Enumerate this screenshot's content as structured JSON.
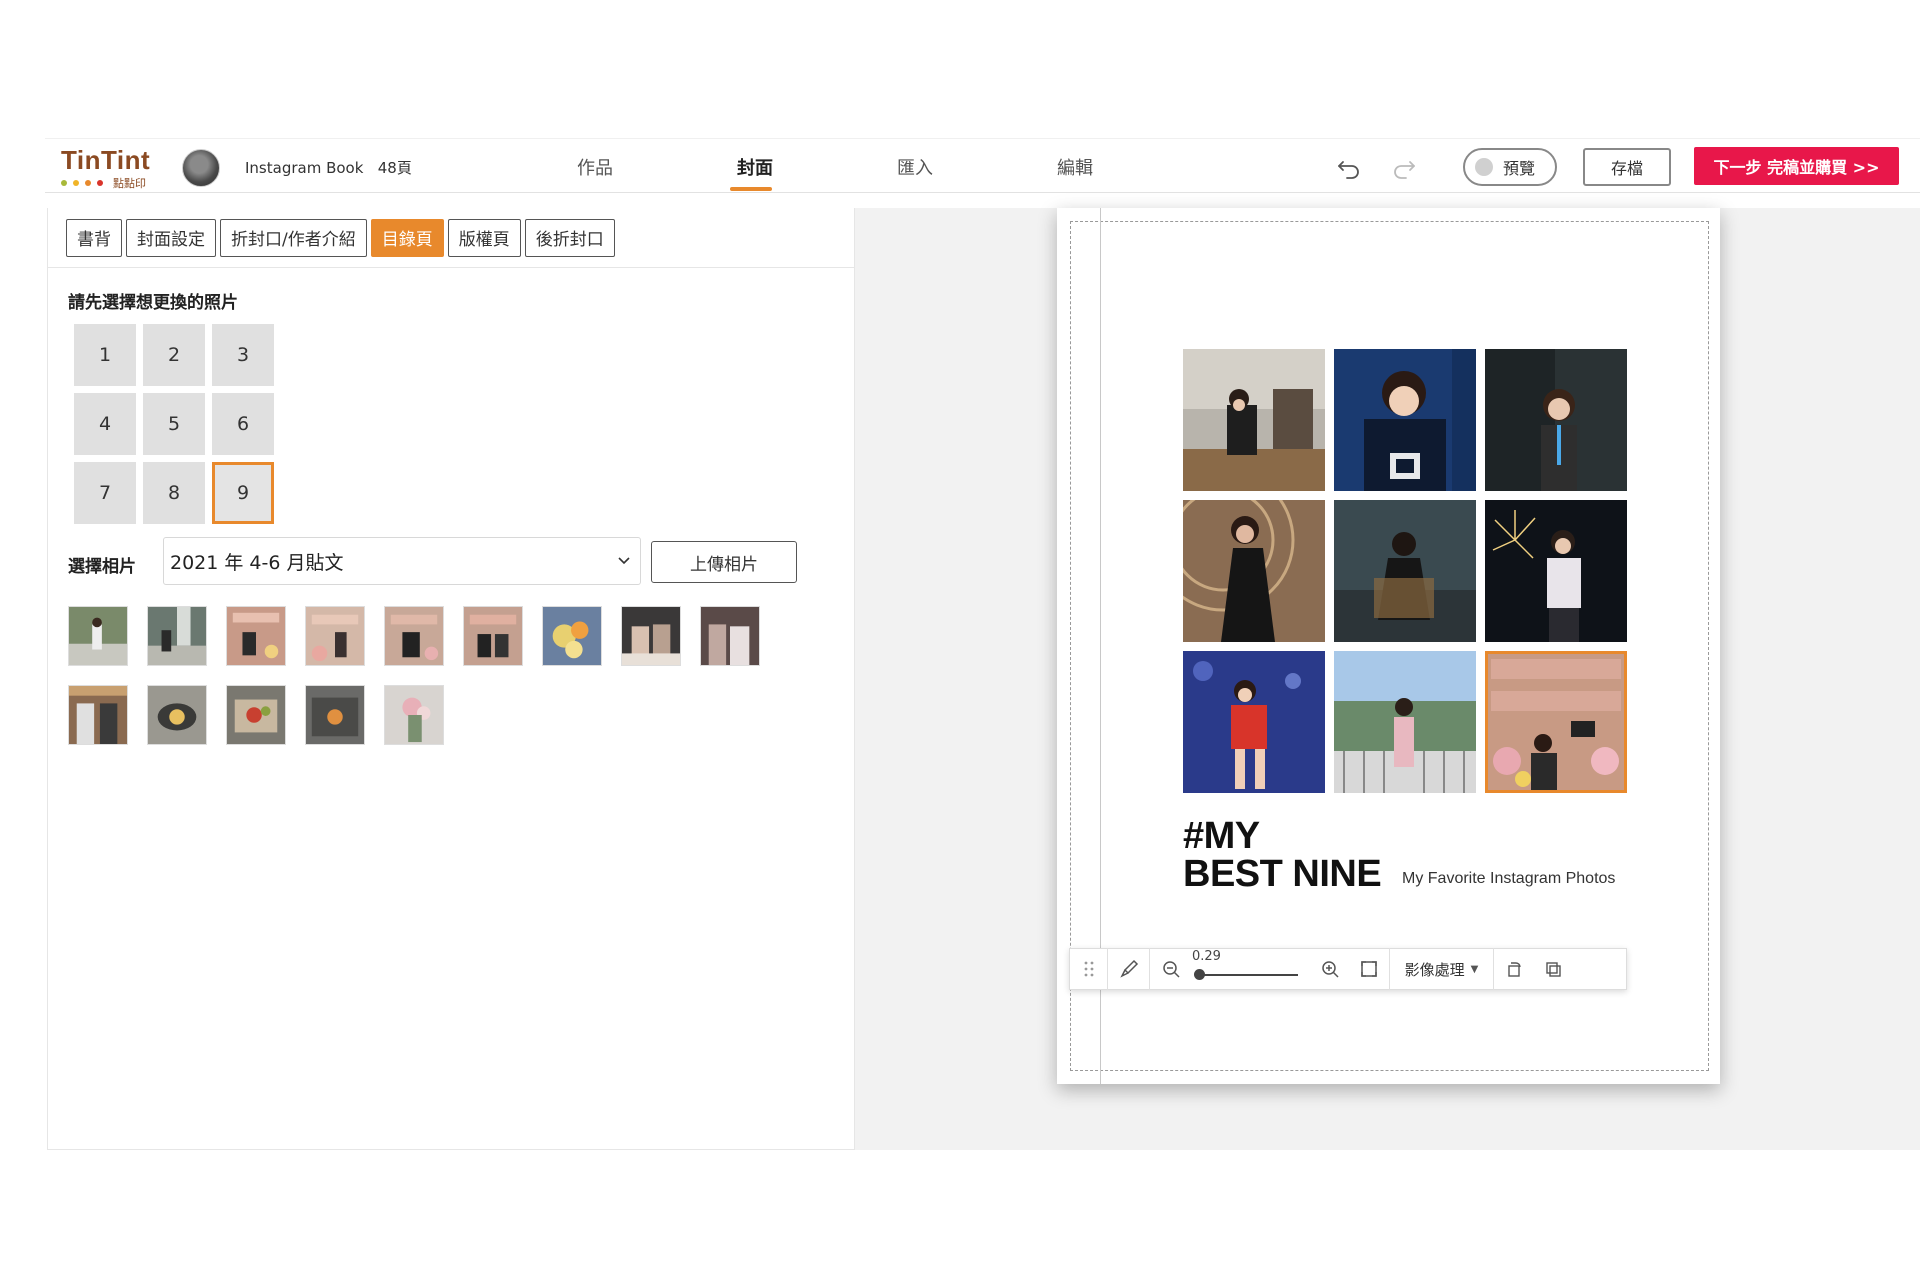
{
  "brand": {
    "name": "TinTint",
    "subtitle": "點點印",
    "dot_colors": [
      "#a8b93a",
      "#f0b429",
      "#e8892c",
      "#d9342b"
    ]
  },
  "book": {
    "title": "Instagram Book",
    "pages": "48頁"
  },
  "nav": {
    "tabs": [
      "作品",
      "封面",
      "匯入",
      "編輯"
    ],
    "active": "封面"
  },
  "toolbar": {
    "undo_icon": "undo-icon",
    "redo_icon": "redo-icon",
    "preview_label": "預覽",
    "save_label": "存檔",
    "next_label": "下一步 完稿並購買 >>"
  },
  "subtabs": {
    "items": [
      "書背",
      "封面設定",
      "折封口/作者介紹",
      "目錄頁",
      "版權頁",
      "後折封口"
    ],
    "active": "目錄頁"
  },
  "panel": {
    "instruction": "請先選擇想更換的照片",
    "grid": [
      "1",
      "2",
      "3",
      "4",
      "5",
      "6",
      "7",
      "8",
      "9"
    ],
    "selected_cell": "9",
    "album_label": "選擇相片",
    "album_value": "2021 年 4-6 月貼文",
    "upload_label": "上傳相片",
    "thumbnail_count": 14
  },
  "cover": {
    "title_line1": "#MY",
    "title_line2": "BEST NINE",
    "subtitle": "My Favorite Instagram Photos",
    "photo_count": 9,
    "selected_photo": 9
  },
  "image_toolbar": {
    "zoom": "0.29",
    "process_label": "影像處理"
  },
  "colors": {
    "accent": "#e8892c",
    "cta": "#e8174a"
  }
}
